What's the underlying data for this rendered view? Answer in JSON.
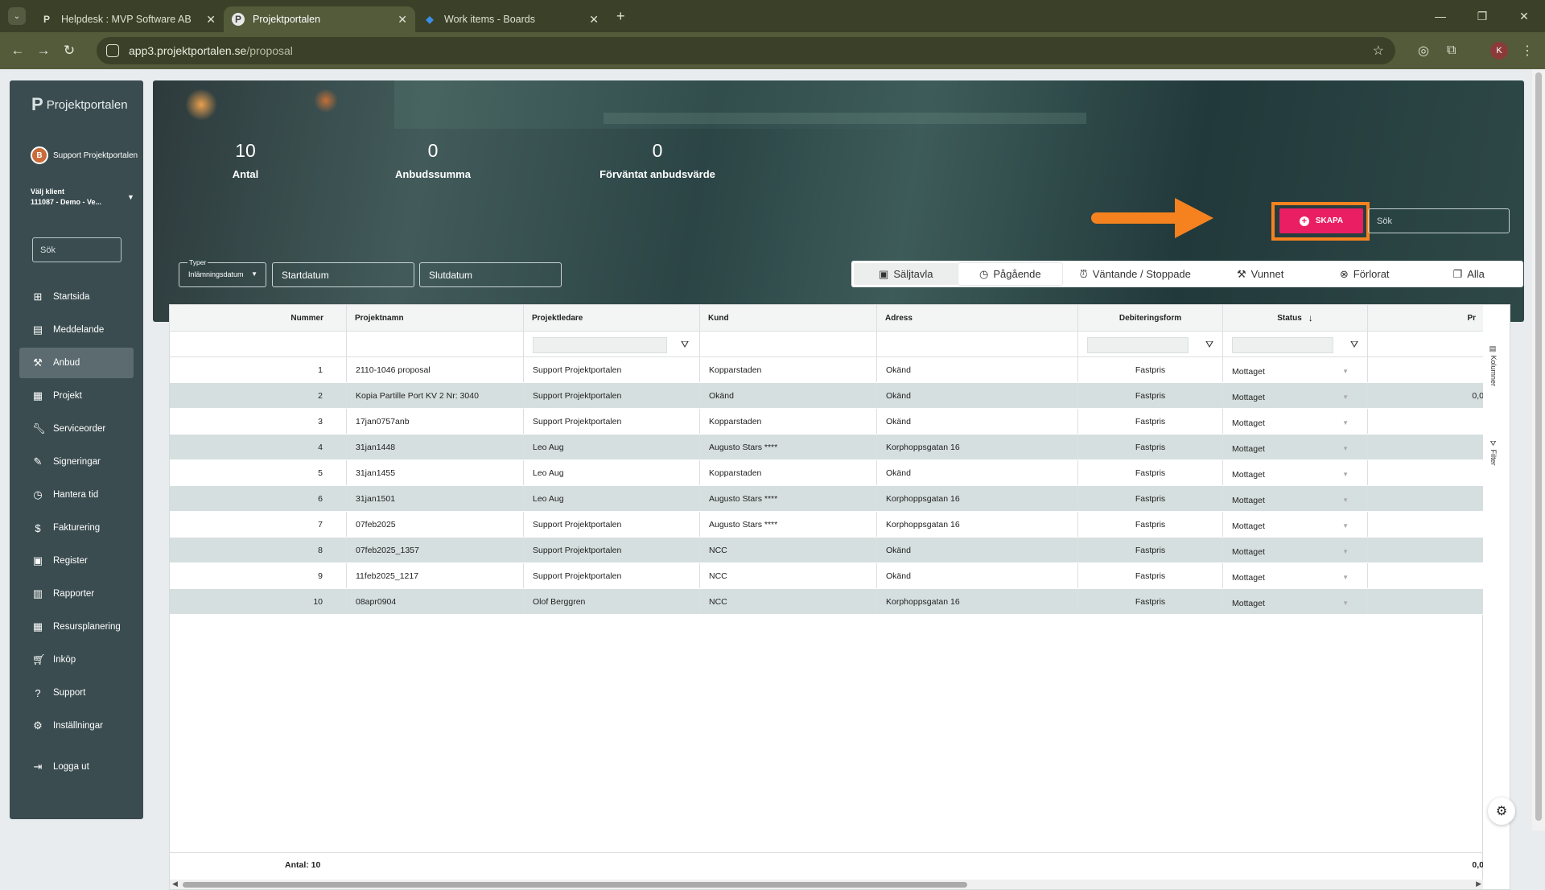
{
  "browser": {
    "tabs": [
      {
        "title": "Helpdesk : MVP Software AB",
        "favicon": "P"
      },
      {
        "title": "Projektportalen",
        "favicon": "P"
      },
      {
        "title": "Work items - Boards",
        "favicon": "azure-devops-icon"
      }
    ],
    "url_host": "app3.projektportalen.se",
    "url_path": "/proposal",
    "profile_initial": "K"
  },
  "sidebar": {
    "logo_text": "Projektportalen",
    "user_name": "Support Projektportalen",
    "user_initial": "B",
    "client_label": "Välj klient",
    "client_value": "111087 - Demo - Ve...",
    "search_placeholder": "Sök",
    "items": [
      {
        "label": "Startsida",
        "icon": "home-icon"
      },
      {
        "label": "Meddelande",
        "icon": "message-icon"
      },
      {
        "label": "Anbud",
        "icon": "gavel-icon"
      },
      {
        "label": "Projekt",
        "icon": "project-icon"
      },
      {
        "label": "Serviceorder",
        "icon": "wrench-icon"
      },
      {
        "label": "Signeringar",
        "icon": "signature-icon"
      },
      {
        "label": "Hantera tid",
        "icon": "clock-icon"
      },
      {
        "label": "Fakturering",
        "icon": "dollar-icon"
      },
      {
        "label": "Register",
        "icon": "register-icon"
      },
      {
        "label": "Rapporter",
        "icon": "report-icon"
      },
      {
        "label": "Resursplanering",
        "icon": "calendar-icon"
      },
      {
        "label": "Inköp",
        "icon": "cart-icon"
      },
      {
        "label": "Support",
        "icon": "help-icon"
      },
      {
        "label": "Inställningar",
        "icon": "gear-icon"
      }
    ],
    "logout_label": "Logga ut"
  },
  "stats": {
    "count_value": "10",
    "count_label": "Antal",
    "sum_value": "0",
    "sum_label": "Anbudssumma",
    "expected_value": "0",
    "expected_label": "Förväntat anbudsvärde"
  },
  "toolbar": {
    "create_label": "SKAPA",
    "search_placeholder": "Sök",
    "type_legend": "Typer",
    "type_value": "Inlämningsdatum",
    "start_placeholder": "Startdatum",
    "end_placeholder": "Slutdatum"
  },
  "view_tabs": [
    "Säljtavla",
    "Pågående",
    "Väntande / Stoppade",
    "Vunnet",
    "Förlorat",
    "Alla"
  ],
  "table": {
    "columns": [
      "Nummer",
      "Projektnamn",
      "Projektledare",
      "Kund",
      "Adress",
      "Debiteringsform",
      "Status",
      "Pr"
    ],
    "rows": [
      [
        "1",
        "2110-1046 proposal",
        "Support Projektportalen",
        "Kopparstaden",
        "Okänd",
        "Fastpris",
        "Mottaget",
        ""
      ],
      [
        "2",
        "Kopia Partille Port KV 2 Nr: 3040",
        "Support Projektportalen",
        "Okänd",
        "Okänd",
        "Fastpris",
        "Mottaget",
        "0,0"
      ],
      [
        "3",
        "17jan0757anb",
        "Support Projektportalen",
        "Kopparstaden",
        "Okänd",
        "Fastpris",
        "Mottaget",
        ""
      ],
      [
        "4",
        "31jan1448",
        "Leo Aug",
        "Augusto Stars ****",
        "Korphoppsgatan 16",
        "Fastpris",
        "Mottaget",
        ""
      ],
      [
        "5",
        "31jan1455",
        "Leo Aug",
        "Kopparstaden",
        "Okänd",
        "Fastpris",
        "Mottaget",
        ""
      ],
      [
        "6",
        "31jan1501",
        "Leo Aug",
        "Augusto Stars ****",
        "Korphoppsgatan 16",
        "Fastpris",
        "Mottaget",
        ""
      ],
      [
        "7",
        "07feb2025",
        "Support Projektportalen",
        "Augusto Stars ****",
        "Korphoppsgatan 16",
        "Fastpris",
        "Mottaget",
        ""
      ],
      [
        "8",
        "07feb2025_1357",
        "Support Projektportalen",
        "NCC",
        "Okänd",
        "Fastpris",
        "Mottaget",
        ""
      ],
      [
        "9",
        "11feb2025_1217",
        "Support Projektportalen",
        "NCC",
        "Okänd",
        "Fastpris",
        "Mottaget",
        ""
      ],
      [
        "10",
        "08apr0904",
        "Olof Berggren",
        "NCC",
        "Korphoppsgatan 16",
        "Fastpris",
        "Mottaget",
        ""
      ]
    ],
    "footer_count": "Antal: 10",
    "footer_sum": "0,0"
  },
  "side_tabs": {
    "columns": "Kolumner",
    "filter": "Filter"
  },
  "colors": {
    "sidebar": "#3a4c50",
    "accent": "#e91e63",
    "highlight": "#f5821f",
    "row_alt": "#d6dfdf"
  }
}
